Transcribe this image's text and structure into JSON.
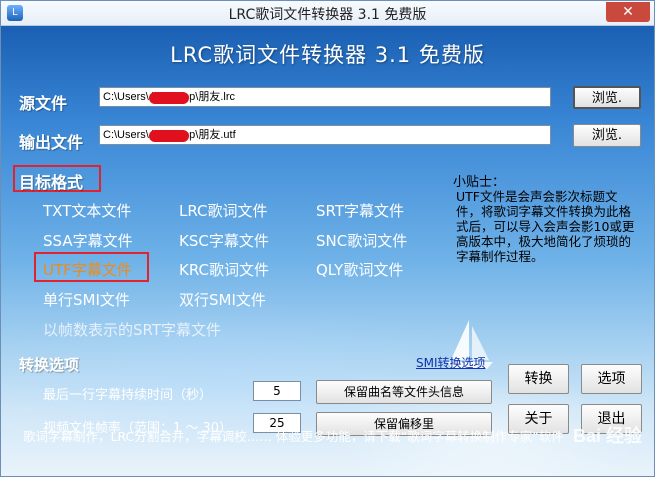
{
  "window": {
    "title": "LRC歌词文件转换器 3.1 免费版",
    "close_glyph": "✕",
    "icon_glyph": "L"
  },
  "app_title": "LRC歌词文件转换器 3.1 免费版",
  "source": {
    "label": "源文件",
    "value": "C:\\Users\\       \\Desktop\\朋友.lrc",
    "browse_label": "浏览."
  },
  "output": {
    "label": "输出文件",
    "value": "C:\\Users\\       \\Desktop\\朋友.utf",
    "browse_label": "浏览."
  },
  "formats": {
    "title": "目标格式",
    "items": [
      {
        "label": "TXT文本文件"
      },
      {
        "label": "LRC歌词文件"
      },
      {
        "label": "SRT字幕文件"
      },
      {
        "label": "SSA字幕文件"
      },
      {
        "label": "KSC字幕文件"
      },
      {
        "label": "SNC歌词文件"
      },
      {
        "label": "UTF字幕文件",
        "selected": true
      },
      {
        "label": "KRC歌词文件"
      },
      {
        "label": "QLY歌词文件"
      },
      {
        "label": "单行SMI文件"
      },
      {
        "label": "双行SMI文件"
      },
      {
        "label": "以帧数表示的SRT字幕文件"
      }
    ]
  },
  "tips": {
    "title": "小贴士：",
    "body": "UTF文件是会声会影次标题文件，将歌词字幕文件转换为此格式后，可以导入会声会影10或更高版本中，极大地简化了烦琐的字幕制作过程。"
  },
  "options": {
    "title": "转换选项",
    "smi_link": "SMI转换选项",
    "last_line_label": "最后一行字幕持续时间（秒）",
    "last_line_value": "5",
    "framerate_label": "视频文件帧率（范围：1 ～ 30）",
    "framerate_value": "25",
    "keep_header_label": "保留曲名等文件头信息",
    "keep_offset_label": "保留偏移里"
  },
  "buttons": {
    "convert": "转换",
    "options": "选项",
    "about": "关于",
    "exit": "退出"
  },
  "footer": "歌词字幕制作，LRC分割合并，字幕调校……  体验更多功能，请下载“歌词字幕转换制作专家”软件",
  "watermark": "Bai 经验",
  "colors": {
    "selected_format": "#f08a1c",
    "highlight_box": "#e0232e",
    "link": "#1033a8"
  }
}
